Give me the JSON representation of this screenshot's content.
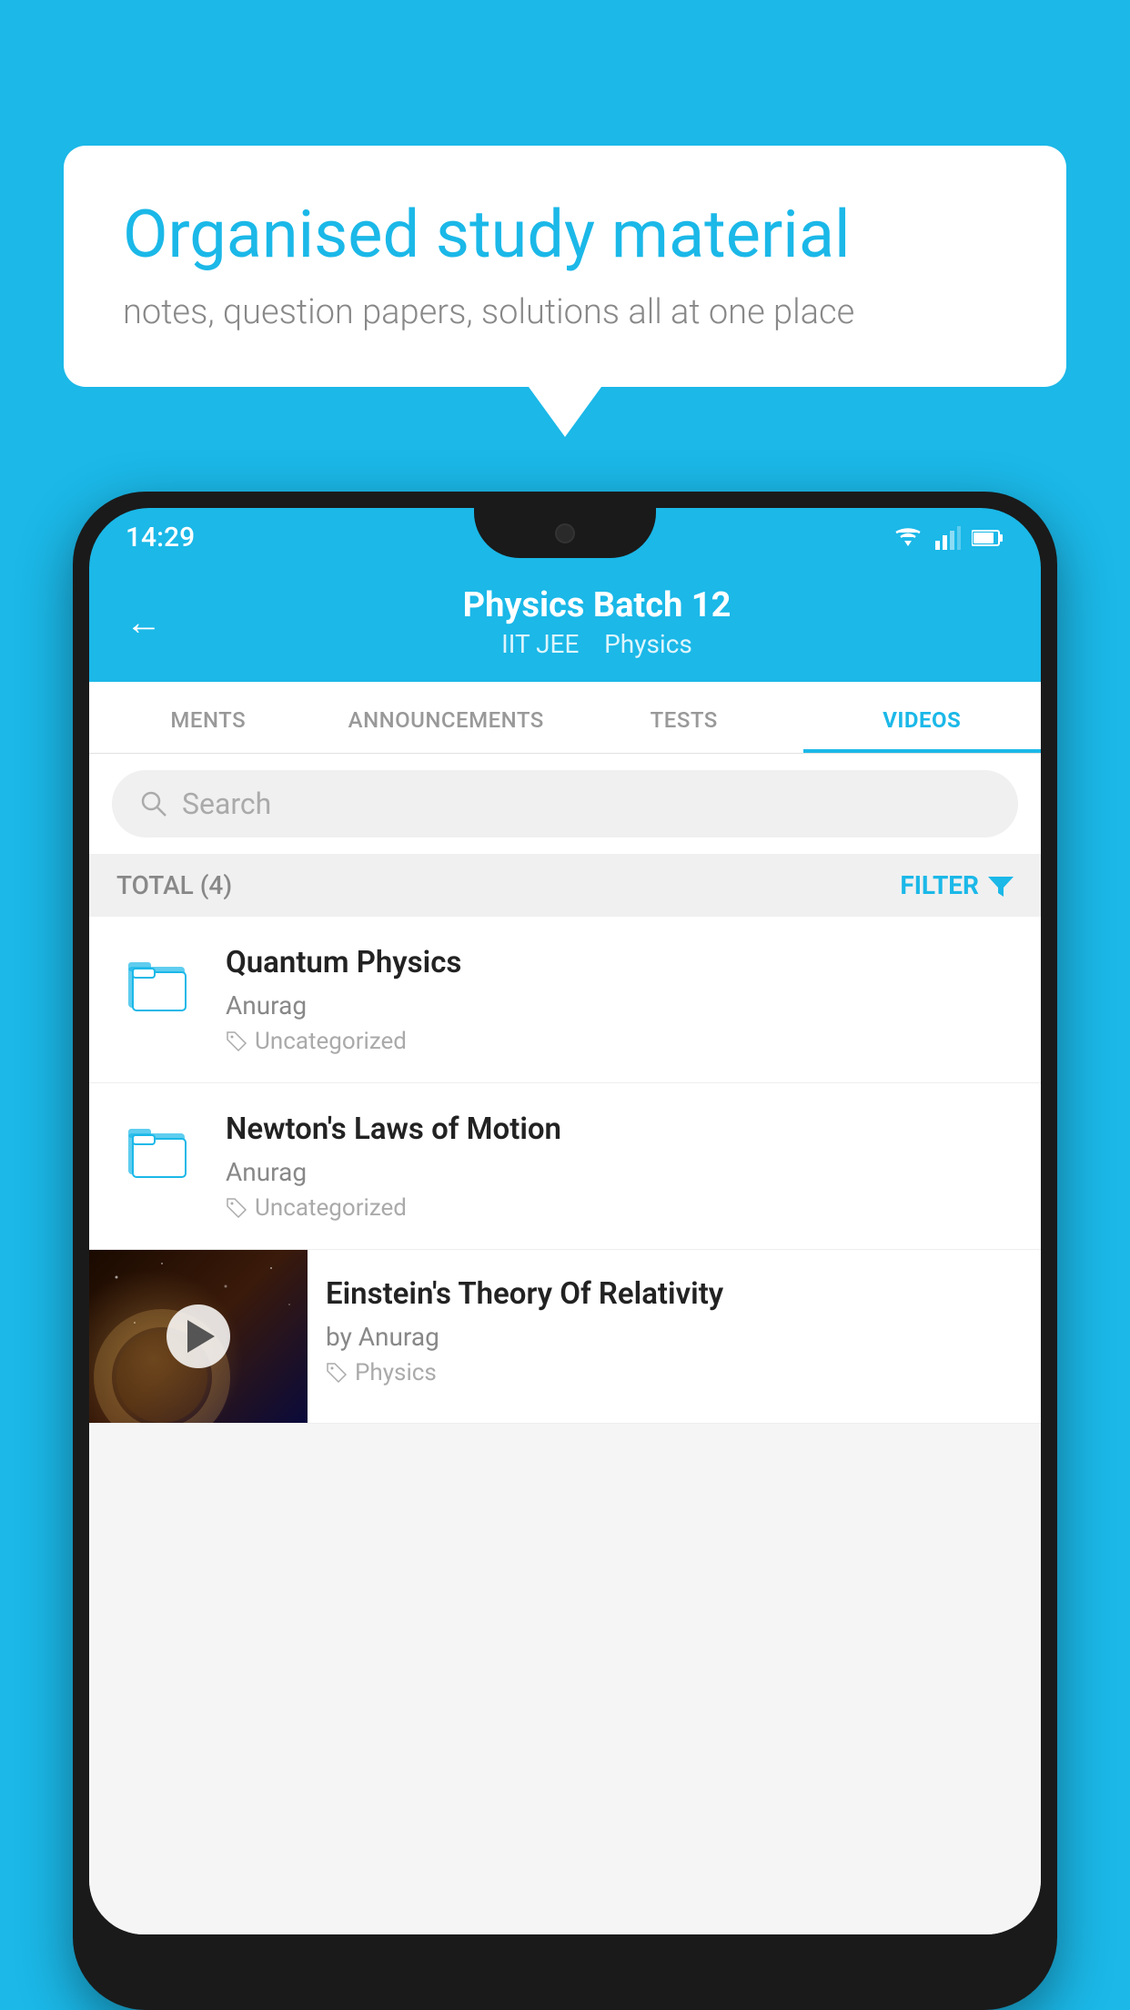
{
  "background_color": "#1BB8E8",
  "speech_bubble": {
    "heading": "Organised study material",
    "subtext": "notes, question papers, solutions all at one place"
  },
  "status_bar": {
    "time": "14:29"
  },
  "app_header": {
    "title": "Physics Batch 12",
    "subtitle_part1": "IIT JEE",
    "subtitle_part2": "Physics",
    "back_label": "←"
  },
  "tabs": [
    {
      "label": "MENTS",
      "active": false
    },
    {
      "label": "ANNOUNCEMENTS",
      "active": false
    },
    {
      "label": "TESTS",
      "active": false
    },
    {
      "label": "VIDEOS",
      "active": true
    }
  ],
  "search": {
    "placeholder": "Search"
  },
  "filter_bar": {
    "total_label": "TOTAL (4)",
    "filter_label": "FILTER"
  },
  "videos": [
    {
      "title": "Quantum Physics",
      "author": "Anurag",
      "tag": "Uncategorized",
      "type": "folder"
    },
    {
      "title": "Newton's Laws of Motion",
      "author": "Anurag",
      "tag": "Uncategorized",
      "type": "folder"
    },
    {
      "title": "Einstein's Theory Of Relativity",
      "author": "by Anurag",
      "tag": "Physics",
      "type": "video"
    }
  ]
}
